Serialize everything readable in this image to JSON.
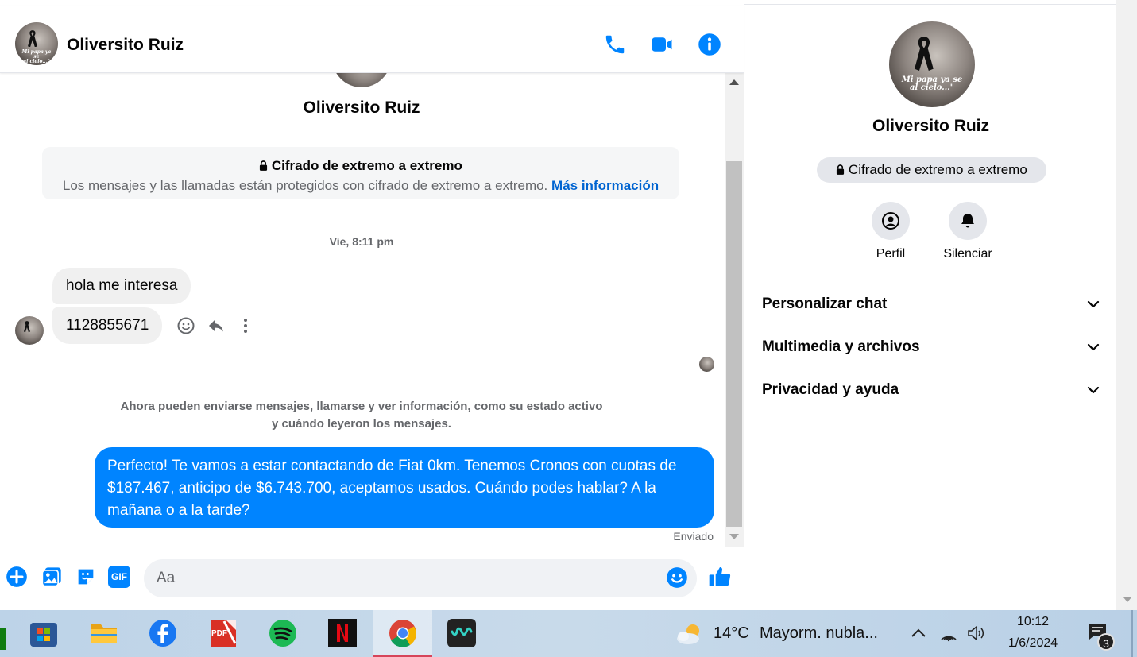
{
  "contact": {
    "name": "Oliversito Ruiz",
    "avatar_caption_line1": "Mi papa ya se",
    "avatar_caption_line2": "al cielo...\""
  },
  "header": {
    "call_icon": "phone-icon",
    "video_icon": "video-camera-icon",
    "info_icon": "info-icon"
  },
  "encryption": {
    "title": "Cifrado de extremo a extremo",
    "description": "Los mensajes y las llamadas están protegidos con cifrado de extremo a extremo.",
    "link": "Más información"
  },
  "conversation": {
    "timestamp": "Vie, 8:11 pm",
    "incoming": [
      {
        "text": "hola me interesa"
      },
      {
        "text": "1128855671"
      }
    ],
    "notice_line1": "Ahora pueden enviarse mensajes, llamarse y ver información, como su estado activo",
    "notice_line2": "y cuándo leyeron los mensajes.",
    "outgoing": {
      "text": "Perfecto! Te vamos a estar contactando de Fiat 0km. Tenemos Cronos con cuotas de $187.467, anticipo de $6.743.700, aceptamos usados. Cuándo podes hablar? A la mañana o a la tarde?",
      "status": "Enviado"
    }
  },
  "composer": {
    "placeholder": "Aa",
    "value": "",
    "gif_label": "GIF"
  },
  "info_panel": {
    "badge": "Cifrado de extremo a extremo",
    "actions": [
      {
        "label": "Perfil",
        "icon": "profile-icon"
      },
      {
        "label": "Silenciar",
        "icon": "bell-icon"
      }
    ],
    "sections": [
      {
        "label": "Personalizar chat"
      },
      {
        "label": "Multimedia y archivos"
      },
      {
        "label": "Privacidad y ayuda"
      }
    ]
  },
  "taskbar": {
    "apps": [
      "microsoft-store-icon",
      "file-explorer-icon",
      "facebook-icon",
      "pdf-icon",
      "spotify-icon",
      "netflix-icon",
      "chrome-icon",
      "app-icon"
    ],
    "pdf_label": "PDF",
    "weather_temp": "14°C",
    "weather_desc": "Mayorm. nubla...",
    "time": "10:12",
    "date": "1/6/2024",
    "notification_count": "3"
  },
  "colors": {
    "accent": "#0084ff",
    "link": "#0064d1",
    "bubble_in": "#f0f0f0",
    "muted_text": "#65676b"
  }
}
